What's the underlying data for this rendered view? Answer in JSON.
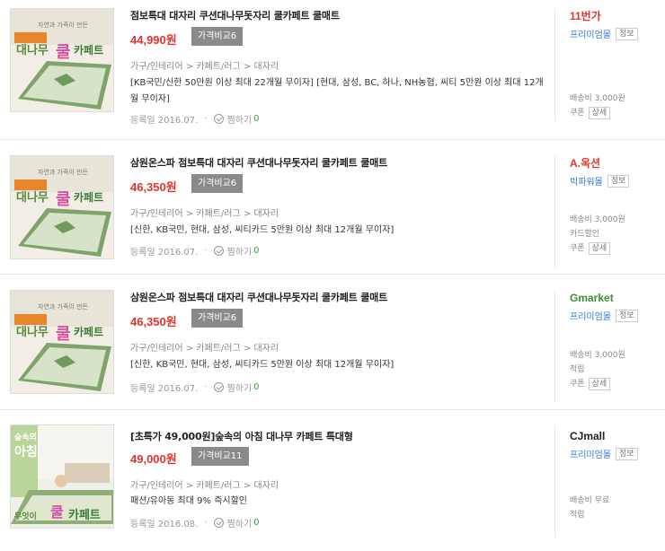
{
  "products": [
    {
      "title": "점보특대 대자리 쿠션대나무돗자리 쿨카페트 쿨매트",
      "price": "44,990원",
      "compare": "가격비교6",
      "category": [
        "가구/인테리어",
        "카페트/러그",
        "대자리"
      ],
      "promo": "[KB국민/신한 50만원 이상 최대 22개월 무이자] [현대, 삼성, BC, 하나, NH농협, 씨티 5만원 이상 최대 12개월 무이자]",
      "reg_date": "등록일 2016.07.",
      "zzim_label": "찜하기",
      "zzim_count": "0",
      "thumb_text": [
        "자연과 가족이 만든",
        "대나무",
        "쿨",
        "카페트"
      ],
      "store": {
        "logo": "11번가",
        "logo_color": "#e2342b",
        "grade": "프리미엄몰",
        "badge": "정보",
        "shipping": "배송비 3,000원",
        "extras": [],
        "coupon": "쿠폰",
        "coupon_badge": "상세"
      }
    },
    {
      "title": "삼원온스파 점보특대 대자리 쿠션대나무돗자리 쿨카페트 쿨매트",
      "price": "46,350원",
      "compare": "가격비교6",
      "category": [
        "가구/인테리어",
        "카페트/러그",
        "대자리"
      ],
      "promo": "[신한, KB국민, 현대, 삼성, 씨티카드 5만원 이상 최대 12개월 무이자]",
      "reg_date": "등록일 2016.07.",
      "zzim_label": "찜하기",
      "zzim_count": "0",
      "thumb_text": [
        "자연과 가족이 만든",
        "대나무",
        "쿨",
        "카페트"
      ],
      "store": {
        "logo": "A.옥션",
        "logo_color": "#e2342b",
        "grade": "빅파워몰",
        "badge": "정보",
        "shipping": "배송비 3,000원",
        "extras": [
          "카드할인"
        ],
        "coupon": "쿠폰",
        "coupon_badge": "상세"
      }
    },
    {
      "title": "삼원온스파 점보특대 대자리 쿠션대나무돗자리 쿨카페트 쿨매트",
      "price": "46,350원",
      "compare": "가격비교6",
      "category": [
        "가구/인테리어",
        "카페트/러그",
        "대자리"
      ],
      "promo": "[신한, KB국민, 현대, 삼성, 씨티카드 5만원 이상 최대 12개월 무이자]",
      "reg_date": "등록일 2016.07.",
      "zzim_label": "찜하기",
      "zzim_count": "0",
      "thumb_text": [
        "자연과 가족이 만든",
        "대나무",
        "쿨",
        "카페트"
      ],
      "store": {
        "logo": "Gmarket",
        "logo_color": "#3f8f3a",
        "grade": "프리미엄몰",
        "badge": "정보",
        "shipping": "배송비 3,000원",
        "extras": [
          "적립"
        ],
        "coupon": "쿠폰",
        "coupon_badge": "상세"
      }
    },
    {
      "title": "[초특가 49,000원]숲속의 아침 대나무 카페트 특대형",
      "price": "49,000원",
      "compare": "가격비교11",
      "category": [
        "가구/인테리어",
        "카페트/러그",
        "대자리"
      ],
      "promo": "패션/유아동 최대 9% 즉시할인",
      "reg_date": "등록일 2016.08.",
      "zzim_label": "찜하기",
      "zzim_count": "0",
      "thumb_text": [
        "숲속의",
        "아침",
        "무엇이",
        "쿨",
        "카페트"
      ],
      "store": {
        "logo": "CJmall",
        "logo_color": "#222222",
        "grade": "프리미엄몰",
        "badge": "정보",
        "shipping": "배송비 무료",
        "extras": [
          "적립"
        ],
        "coupon": "",
        "coupon_badge": ""
      }
    }
  ],
  "colors": {
    "price": "#e2342b",
    "grade": "#2d7bd2",
    "compare_bg": "#8a8a8a"
  }
}
